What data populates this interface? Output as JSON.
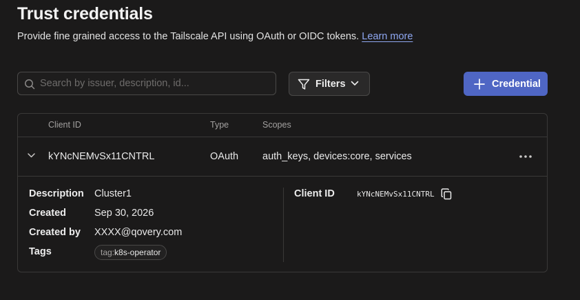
{
  "header": {
    "title": "Trust credentials",
    "subtitle": "Provide fine grained access to the Tailscale API using OAuth or OIDC tokens.",
    "learn_more": "Learn more"
  },
  "toolbar": {
    "search_placeholder": "Search by issuer, description, id...",
    "search_value": "",
    "filters_label": "Filters",
    "credential_label": "Credential"
  },
  "table": {
    "columns": [
      "Client ID",
      "Type",
      "Scopes"
    ],
    "rows": [
      {
        "client_id": "kYNcNEMvSx11CNTRL",
        "type": "OAuth",
        "scopes": "auth_keys, devices:core, services",
        "expanded": true,
        "details": {
          "description_label": "Description",
          "description": "Cluster1",
          "created_label": "Created",
          "created": "Sep 30, 2026",
          "created_by_label": "Created by",
          "created_by": "XXXX@qovery.com",
          "tags_label": "Tags",
          "tag_key": "tag:",
          "tag_value": "k8s-operator",
          "client_id_label": "Client ID",
          "client_id": "kYNcNEMvSx11CNTRL"
        }
      }
    ]
  },
  "icons": {
    "search": "search-icon",
    "filters": "filter-icon",
    "filters_chevron": "chevron-down-icon",
    "credential": "plus-icon",
    "expand": "chevron-down-icon",
    "more": "more-horizontal-icon",
    "copy": "copy-icon"
  },
  "colors": {
    "background": "#1b1a1a",
    "primary_button": "#4f66c4",
    "link": "#8fa8f2",
    "border": "#3a3938"
  }
}
